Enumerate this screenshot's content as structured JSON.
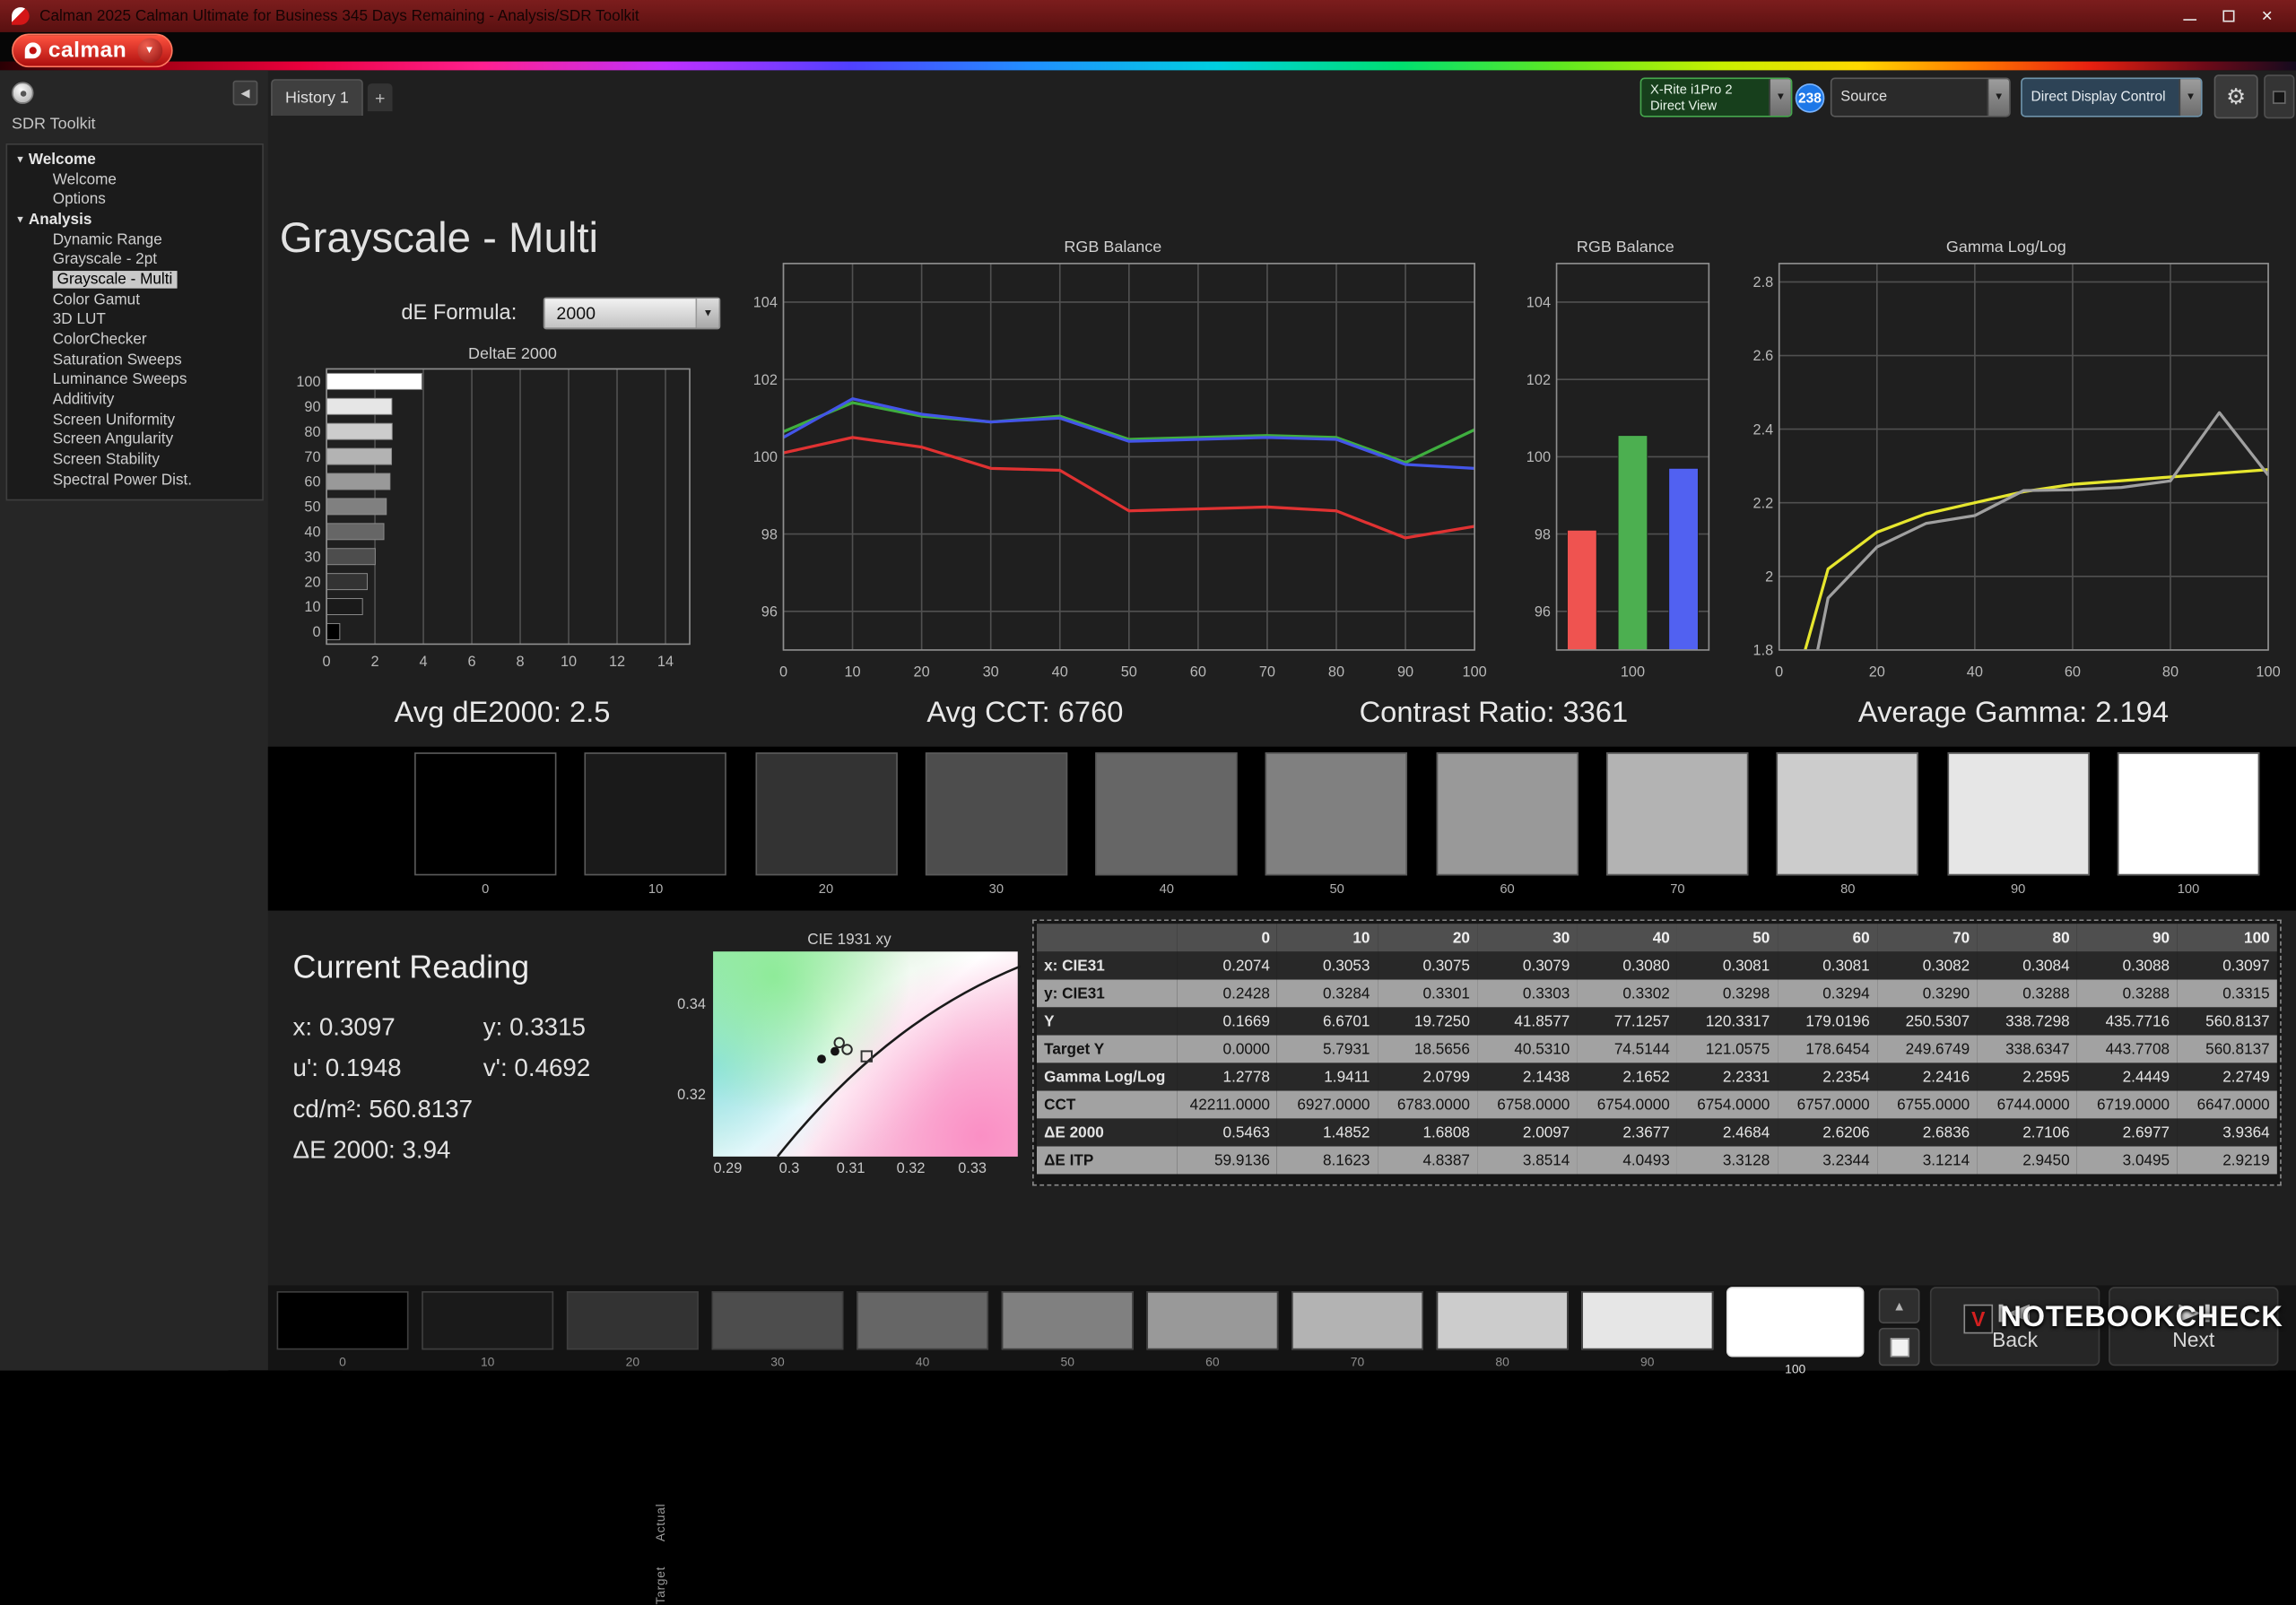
{
  "window": {
    "title": "Calman 2025 Calman Ultimate for Business 345 Days Remaining  - Analysis/SDR Toolkit"
  },
  "brand": {
    "wordmark": "calman"
  },
  "icons": {
    "close": "×",
    "dropdown_arrow": "▼",
    "collapse_left": "◀",
    "gear": "⚙",
    "plus": "+",
    "up_chevron": "▲",
    "tree_caret": "▾",
    "watermark_logo": "V"
  },
  "colors": {
    "brand_red": "#d41617",
    "badge_blue": "#1e78e8",
    "meter_green": "#46a84d",
    "rgb_red": "#e03232",
    "rgb_green": "#3fae3f",
    "rgb_blue": "#4355e8",
    "target_yellow": "#e6e62e",
    "measured_gray": "#a0a0a0"
  },
  "topbar": {
    "history_tab": "History 1",
    "meter_line1": "X-Rite i1Pro 2",
    "meter_line2": "Direct View",
    "badge_count": "238",
    "source_label": "Source",
    "display_control_label": "Direct Display Control"
  },
  "sidebar": {
    "title": "SDR Toolkit",
    "tree": [
      {
        "label": "Welcome",
        "type": "group"
      },
      {
        "label": "Welcome",
        "type": "item"
      },
      {
        "label": "Options",
        "type": "item"
      },
      {
        "label": "Analysis",
        "type": "group"
      },
      {
        "label": "Dynamic Range",
        "type": "item"
      },
      {
        "label": "Grayscale - 2pt",
        "type": "item"
      },
      {
        "label": "Grayscale - Multi",
        "type": "item",
        "selected": true
      },
      {
        "label": "Color Gamut",
        "type": "item"
      },
      {
        "label": "3D LUT",
        "type": "item"
      },
      {
        "label": "ColorChecker",
        "type": "item"
      },
      {
        "label": "Saturation Sweeps",
        "type": "item"
      },
      {
        "label": "Luminance Sweeps",
        "type": "item"
      },
      {
        "label": "Additivity",
        "type": "item"
      },
      {
        "label": "Screen Uniformity",
        "type": "item"
      },
      {
        "label": "Screen Angularity",
        "type": "item"
      },
      {
        "label": "Screen Stability",
        "type": "item"
      },
      {
        "label": "Spectral Power Dist.",
        "type": "item"
      }
    ]
  },
  "page": {
    "title": "Grayscale - Multi",
    "de_formula_label": "dE Formula:",
    "de_formula_value": "2000"
  },
  "stats": [
    "Avg dE2000: 2.5",
    "Avg CCT: 6760",
    "Contrast Ratio: 3361",
    "Average Gamma: 2.194"
  ],
  "patches": {
    "labels": [
      "0",
      "10",
      "20",
      "30",
      "40",
      "50",
      "60",
      "70",
      "80",
      "90",
      "100"
    ],
    "colors": [
      "#000000",
      "#1a1a1a",
      "#333333",
      "#4d4d4d",
      "#666666",
      "#808080",
      "#999999",
      "#b3b3b3",
      "#cccccc",
      "#e6e6e6",
      "#ffffff"
    ],
    "actual_label": "Actual",
    "target_label": "Target",
    "selected": "100"
  },
  "reading": {
    "title": "Current Reading",
    "lines": [
      "x: 0.3097",
      "y: 0.3315",
      "u': 0.1948",
      "v': 0.4692",
      "cd/m²: 560.8137",
      "ΔE 2000: 3.94"
    ]
  },
  "cie": {
    "title": "CIE 1931 xy",
    "yticks": [
      "0.34",
      "0.32"
    ],
    "xticks": [
      "0.29",
      "0.3",
      "0.31",
      "0.32",
      "0.33"
    ],
    "points": [
      {
        "x": 0.3053,
        "y": 0.3284,
        "t": "dot"
      },
      {
        "x": 0.3075,
        "y": 0.3301,
        "t": "dot"
      },
      {
        "x": 0.3082,
        "y": 0.332,
        "t": "ring"
      },
      {
        "x": 0.3095,
        "y": 0.3305,
        "t": "ring"
      },
      {
        "x": 0.3127,
        "y": 0.329,
        "t": "square"
      }
    ]
  },
  "table": {
    "col_headers": [
      "",
      "0",
      "10",
      "20",
      "30",
      "40",
      "50",
      "60",
      "70",
      "80",
      "90",
      "100"
    ],
    "rows": [
      {
        "label": "x: CIE31",
        "values": [
          "0.2074",
          "0.3053",
          "0.3075",
          "0.3079",
          "0.3080",
          "0.3081",
          "0.3081",
          "0.3082",
          "0.3084",
          "0.3088",
          "0.3097"
        ]
      },
      {
        "label": "y: CIE31",
        "values": [
          "0.2428",
          "0.3284",
          "0.3301",
          "0.3303",
          "0.3302",
          "0.3298",
          "0.3294",
          "0.3290",
          "0.3288",
          "0.3288",
          "0.3315"
        ]
      },
      {
        "label": "Y",
        "values": [
          "0.1669",
          "6.6701",
          "19.7250",
          "41.8577",
          "77.1257",
          "120.3317",
          "179.0196",
          "250.5307",
          "338.7298",
          "435.7716",
          "560.8137"
        ]
      },
      {
        "label": "Target Y",
        "values": [
          "0.0000",
          "5.7931",
          "18.5656",
          "40.5310",
          "74.5144",
          "121.0575",
          "178.6454",
          "249.6749",
          "338.6347",
          "443.7708",
          "560.8137"
        ]
      },
      {
        "label": "Gamma Log/Log",
        "values": [
          "1.2778",
          "1.9411",
          "2.0799",
          "2.1438",
          "2.1652",
          "2.2331",
          "2.2354",
          "2.2416",
          "2.2595",
          "2.4449",
          "2.2749"
        ]
      },
      {
        "label": "CCT",
        "values": [
          "42211.0000",
          "6927.0000",
          "6783.0000",
          "6758.0000",
          "6754.0000",
          "6754.0000",
          "6757.0000",
          "6755.0000",
          "6744.0000",
          "6719.0000",
          "6647.0000"
        ]
      },
      {
        "label": "ΔE 2000",
        "values": [
          "0.5463",
          "1.4852",
          "1.6808",
          "2.0097",
          "2.3677",
          "2.4684",
          "2.6206",
          "2.6836",
          "2.7106",
          "2.6977",
          "3.9364"
        ]
      },
      {
        "label": "ΔE ITP",
        "values": [
          "59.9136",
          "8.1623",
          "4.8387",
          "3.8514",
          "4.0493",
          "3.3128",
          "3.2344",
          "3.1214",
          "2.9450",
          "3.0495",
          "2.9219"
        ]
      }
    ]
  },
  "bottombar": {
    "back": "Back",
    "next": "Next",
    "watermark": "NOTEBOOKCHECK"
  },
  "chart_data": [
    {
      "type": "bar",
      "orientation": "horizontal",
      "title": "DeltaE 2000",
      "categories": [
        "100",
        "90",
        "80",
        "70",
        "60",
        "50",
        "40",
        "30",
        "20",
        "10",
        "0"
      ],
      "values": [
        3.9364,
        2.6977,
        2.7106,
        2.6836,
        2.6206,
        2.4684,
        2.3677,
        2.0097,
        1.6808,
        1.4852,
        0.5463
      ],
      "xlim": [
        0,
        15
      ],
      "xticks": [
        0,
        2,
        4,
        6,
        8,
        10,
        12,
        14
      ]
    },
    {
      "type": "line",
      "title": "RGB Balance",
      "x": [
        0,
        10,
        20,
        30,
        40,
        50,
        60,
        70,
        80,
        90,
        100
      ],
      "series": [
        {
          "name": "Red",
          "color": "#e03232",
          "values": [
            100.1,
            100.5,
            100.25,
            99.7,
            99.65,
            98.6,
            98.65,
            98.7,
            98.6,
            97.9,
            98.2
          ]
        },
        {
          "name": "Green",
          "color": "#3fae3f",
          "values": [
            100.65,
            101.4,
            101.05,
            100.9,
            101.05,
            100.45,
            100.5,
            100.55,
            100.5,
            99.85,
            100.7
          ]
        },
        {
          "name": "Blue",
          "color": "#4355e8",
          "values": [
            100.5,
            101.5,
            101.1,
            100.9,
            101.0,
            100.4,
            100.45,
            100.5,
            100.45,
            99.8,
            99.7
          ]
        }
      ],
      "ylim": [
        95,
        105
      ],
      "yticks": [
        96,
        98,
        100,
        102,
        104
      ],
      "xticks": [
        0,
        10,
        20,
        30,
        40,
        50,
        60,
        70,
        80,
        90,
        100
      ]
    },
    {
      "type": "bar",
      "title": "RGB Balance",
      "categories": [
        "Red",
        "Green",
        "Blue"
      ],
      "values": [
        98.1,
        100.55,
        99.7
      ],
      "colors": [
        "#ef5350",
        "#4caf50",
        "#5161f1"
      ],
      "ylim": [
        95,
        105
      ],
      "yticks": [
        96,
        98,
        100,
        102,
        104
      ],
      "xlabel": "100"
    },
    {
      "type": "line",
      "title": "Gamma Log/Log",
      "x": [
        0,
        10,
        20,
        30,
        40,
        50,
        60,
        70,
        80,
        90,
        100
      ],
      "series": [
        {
          "name": "Target",
          "color": "#e6e62e",
          "values": [
            1.55,
            2.02,
            2.12,
            2.17,
            2.2,
            2.23,
            2.25,
            2.26,
            2.27,
            2.28,
            2.29
          ]
        },
        {
          "name": "Measured",
          "color": "#a0a0a0",
          "values": [
            1.2778,
            1.9411,
            2.0799,
            2.1438,
            2.1652,
            2.2331,
            2.2354,
            2.2416,
            2.2595,
            2.4449,
            2.2749
          ]
        }
      ],
      "ylim": [
        1.8,
        2.85
      ],
      "yticks": [
        1.8,
        2.0,
        2.2,
        2.4,
        2.6,
        2.8
      ],
      "ytick_labels": [
        "1.8",
        "2",
        "2.2",
        "2.4",
        "2.6",
        "2.8"
      ],
      "xticks": [
        0,
        20,
        40,
        60,
        80,
        100
      ]
    }
  ]
}
